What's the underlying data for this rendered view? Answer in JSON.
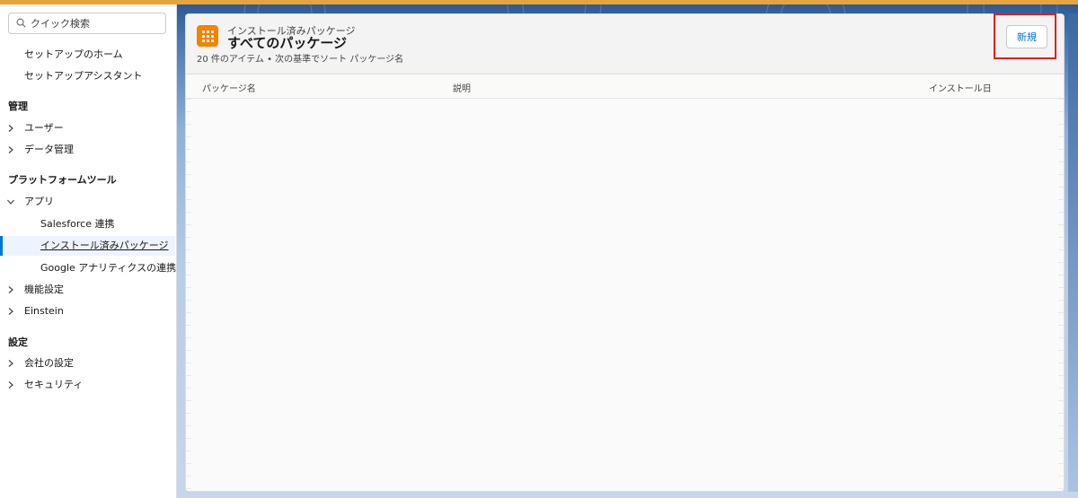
{
  "sidebar": {
    "search_placeholder": "クイック検索",
    "home": "セットアップのホーム",
    "assistant": "セットアップアシスタント",
    "sections": {
      "admin": "管理",
      "platform_tools": "プラットフォームツール",
      "settings": "設定"
    },
    "items": {
      "users": "ユーザー",
      "data_management": "データ管理",
      "apps": "アプリ",
      "salesforce_connect": "Salesforce 連携",
      "installed_packages": "インストール済みパッケージ",
      "google_analytics": "Google アナリティクスの連携",
      "feature_settings": "機能設定",
      "einstein": "Einstein",
      "company_settings": "会社の設定",
      "security": "セキュリティ"
    }
  },
  "header": {
    "eyebrow": "インストール済みパッケージ",
    "title": "すべてのパッケージ",
    "meta": "20 件のアイテム • 次の基準でソート パッケージ名",
    "new_button": "新規"
  },
  "table": {
    "columns": [
      "パッケージ名",
      "説明",
      "インストール日"
    ]
  },
  "colors": {
    "accent": "#0176d3",
    "icon_orange": "#f38303",
    "highlight_red": "#e0201f",
    "top_bar": "#e8a33d"
  }
}
